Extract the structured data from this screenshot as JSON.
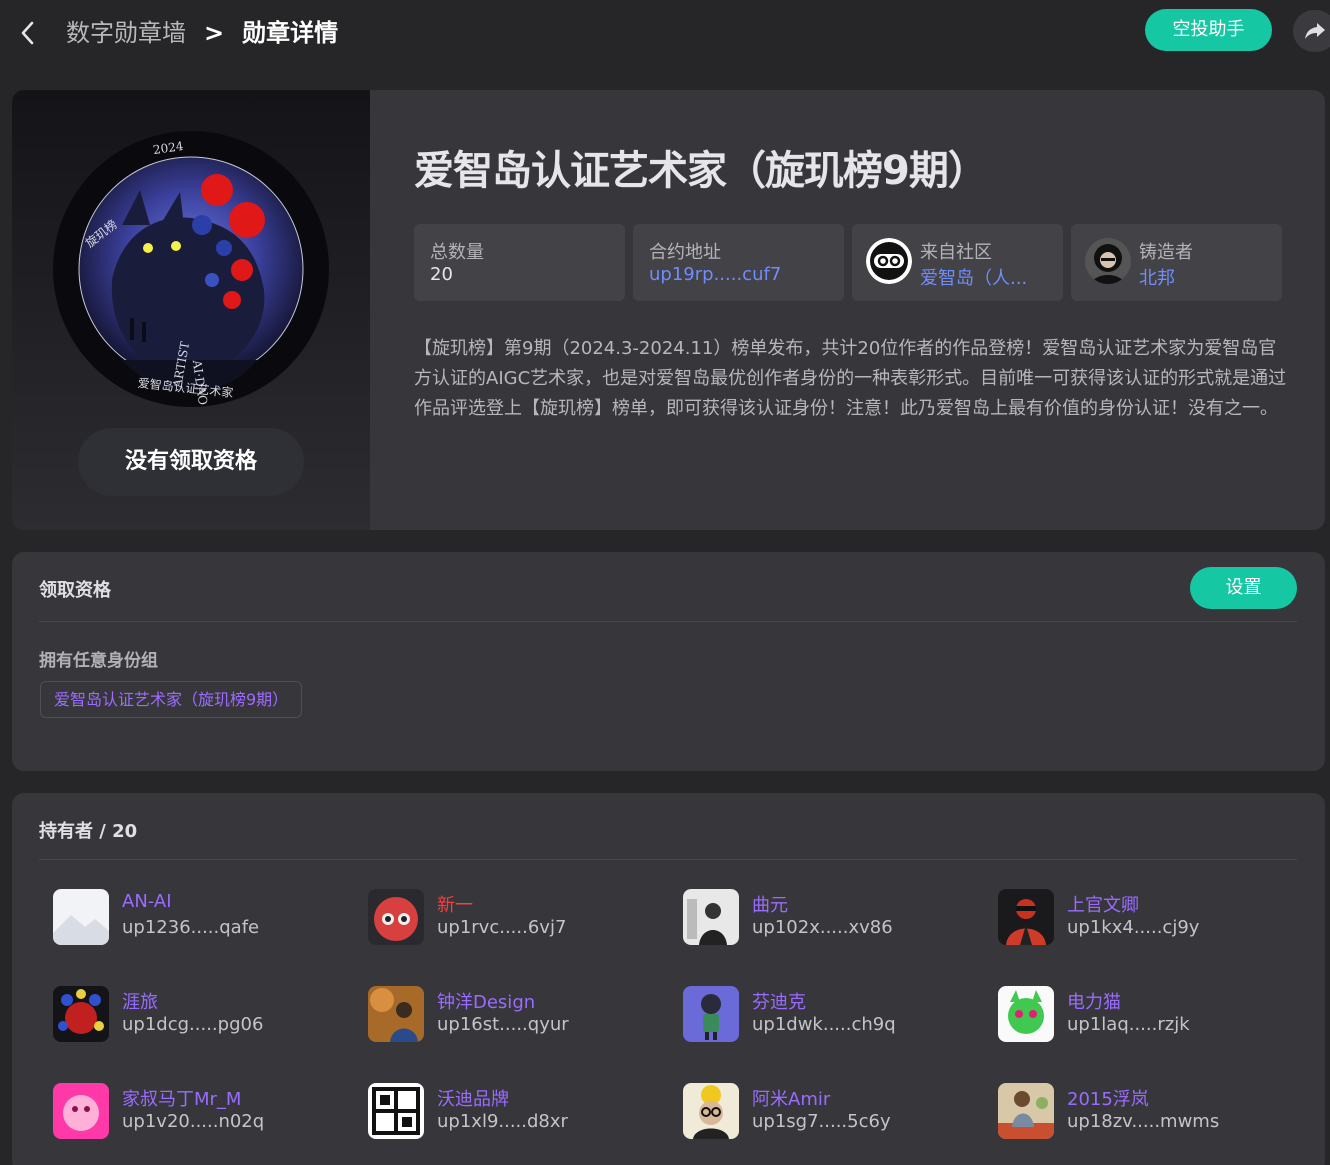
{
  "header": {
    "crumb_parent": "数字勋章墙",
    "crumb_sep": ">",
    "crumb_current": "勋章详情",
    "airdrop_label": "空投助手"
  },
  "medal": {
    "title": "爱智岛认证艺术家（旋玑榜9期）",
    "status_label": "没有领取资格",
    "total_label": "总数量",
    "total_value": "20",
    "contract_label": "合约地址",
    "contract_value": "up19rp.....cuf7",
    "community_label": "来自社区",
    "community_value": "爱智岛（人...",
    "creator_label": "铸造者",
    "creator_value": "北邦",
    "description": "【旋玑榜】第9期（2024.3-2024.11）榜单发布，共计20位作者的作品登榜！爱智岛认证艺术家为爱智岛官方认证的AIGC艺术家，也是对爱智岛最优创作者身份的一种表彰形式。目前唯一可获得该认证的形式就是通过作品评选登上【旋玑榜】榜单，即可获得该认证身份！注意！此乃爱智岛上最有价值的身份认证！没有之一。"
  },
  "eligibility": {
    "title": "领取资格",
    "settings_label": "设置",
    "condition_label": "拥有任意身份组",
    "role_tag": "爱智岛认证艺术家（旋玑榜9期）"
  },
  "holders": {
    "title": "持有者 / 20",
    "items": [
      {
        "name": "AN-AI",
        "addr": "up1236.....qafe"
      },
      {
        "name": "新一",
        "addr": "up1rvc.....6vj7"
      },
      {
        "name": "曲元",
        "addr": "up102x.....xv86"
      },
      {
        "name": "上官文卿",
        "addr": "up1kx4.....cj9y"
      },
      {
        "name": "涯旅",
        "addr": "up1dcg.....pg06"
      },
      {
        "name": "钟洋Design",
        "addr": "up16st.....qyur"
      },
      {
        "name": "芬迪克",
        "addr": "up1dwk.....ch9q"
      },
      {
        "name": "电力猫",
        "addr": "up1laq.....rzjk"
      },
      {
        "name": "家叔马丁Mr_M",
        "addr": "up1v20.....n02q"
      },
      {
        "name": "沃迪品牌",
        "addr": "up1xl9.....d8xr"
      },
      {
        "name": "阿米Amir",
        "addr": "up1sg7.....5c6y"
      },
      {
        "name": "2015浮岚",
        "addr": "up18zv.....mwms"
      }
    ]
  },
  "colors": {
    "accent": "#15c7a3",
    "link": "#6f8dff",
    "name": "#9a6bff",
    "red_name": "#ff3b3b"
  }
}
